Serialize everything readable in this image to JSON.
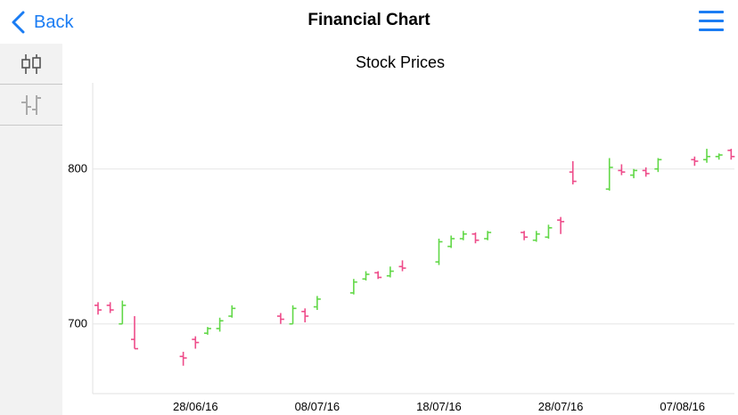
{
  "navbar": {
    "back_label": "Back",
    "title": "Financial Chart"
  },
  "icons": {
    "back": "chevron-left-icon",
    "menu": "hamburger-menu-icon",
    "candlestick": "candlestick-chart-icon",
    "ohlc": "ohlc-chart-icon"
  },
  "colors": {
    "accent": "#1a7cf3",
    "up": "#62d848",
    "down": "#ee4c8a"
  },
  "chart_data": {
    "type": "ohlc",
    "title": "Stock Prices",
    "xlabel": "",
    "ylabel": "",
    "ylim": [
      655,
      855
    ],
    "xlim": [
      "2016-06-20",
      "2016-08-12"
    ],
    "yticks": [
      700,
      800
    ],
    "xticks": [
      "28/06/16",
      "08/07/16",
      "18/07/16",
      "28/07/16",
      "07/08/16"
    ],
    "grid": true,
    "series": [
      {
        "date": "2016-06-20",
        "open": 712,
        "high": 714,
        "low": 706,
        "close": 709
      },
      {
        "date": "2016-06-21",
        "open": 712,
        "high": 714,
        "low": 707,
        "close": 709
      },
      {
        "date": "2016-06-22",
        "open": 700,
        "high": 715,
        "low": 700,
        "close": 712
      },
      {
        "date": "2016-06-23",
        "open": 690,
        "high": 705,
        "low": 684,
        "close": 684
      },
      {
        "date": "2016-06-27",
        "open": 679,
        "high": 682,
        "low": 673,
        "close": 678
      },
      {
        "date": "2016-06-28",
        "open": 690,
        "high": 692,
        "low": 684,
        "close": 688
      },
      {
        "date": "2016-06-29",
        "open": 694,
        "high": 698,
        "low": 693,
        "close": 697
      },
      {
        "date": "2016-06-30",
        "open": 697,
        "high": 704,
        "low": 695,
        "close": 702
      },
      {
        "date": "2016-07-01",
        "open": 705,
        "high": 712,
        "low": 704,
        "close": 710
      },
      {
        "date": "2016-07-05",
        "open": 705,
        "high": 707,
        "low": 700,
        "close": 703
      },
      {
        "date": "2016-07-06",
        "open": 700,
        "high": 712,
        "low": 700,
        "close": 710
      },
      {
        "date": "2016-07-07",
        "open": 708,
        "high": 710,
        "low": 701,
        "close": 705
      },
      {
        "date": "2016-07-08",
        "open": 711,
        "high": 718,
        "low": 709,
        "close": 716
      },
      {
        "date": "2016-07-11",
        "open": 720,
        "high": 729,
        "low": 719,
        "close": 727
      },
      {
        "date": "2016-07-12",
        "open": 729,
        "high": 734,
        "low": 728,
        "close": 732
      },
      {
        "date": "2016-07-13",
        "open": 733,
        "high": 734,
        "low": 729,
        "close": 730
      },
      {
        "date": "2016-07-14",
        "open": 731,
        "high": 737,
        "low": 730,
        "close": 734
      },
      {
        "date": "2016-07-15",
        "open": 737,
        "high": 741,
        "low": 734,
        "close": 736
      },
      {
        "date": "2016-07-18",
        "open": 740,
        "high": 755,
        "low": 738,
        "close": 753
      },
      {
        "date": "2016-07-19",
        "open": 750,
        "high": 757,
        "low": 749,
        "close": 755
      },
      {
        "date": "2016-07-20",
        "open": 755,
        "high": 760,
        "low": 754,
        "close": 758
      },
      {
        "date": "2016-07-21",
        "open": 758,
        "high": 759,
        "low": 752,
        "close": 754
      },
      {
        "date": "2016-07-22",
        "open": 755,
        "high": 760,
        "low": 754,
        "close": 759
      },
      {
        "date": "2016-07-25",
        "open": 759,
        "high": 760,
        "low": 754,
        "close": 756
      },
      {
        "date": "2016-07-26",
        "open": 754,
        "high": 760,
        "low": 753,
        "close": 758
      },
      {
        "date": "2016-07-27",
        "open": 756,
        "high": 764,
        "low": 755,
        "close": 762
      },
      {
        "date": "2016-07-28",
        "open": 767,
        "high": 769,
        "low": 758,
        "close": 766
      },
      {
        "date": "2016-07-29",
        "open": 798,
        "high": 805,
        "low": 790,
        "close": 792
      },
      {
        "date": "2016-08-01",
        "open": 787,
        "high": 807,
        "low": 786,
        "close": 801
      },
      {
        "date": "2016-08-02",
        "open": 799,
        "high": 803,
        "low": 796,
        "close": 798
      },
      {
        "date": "2016-08-03",
        "open": 796,
        "high": 800,
        "low": 794,
        "close": 799
      },
      {
        "date": "2016-08-04",
        "open": 799,
        "high": 801,
        "low": 795,
        "close": 797
      },
      {
        "date": "2016-08-05",
        "open": 800,
        "high": 807,
        "low": 798,
        "close": 806
      },
      {
        "date": "2016-08-08",
        "open": 806,
        "high": 808,
        "low": 802,
        "close": 805
      },
      {
        "date": "2016-08-09",
        "open": 806,
        "high": 813,
        "low": 804,
        "close": 808
      },
      {
        "date": "2016-08-10",
        "open": 808,
        "high": 810,
        "low": 806,
        "close": 809
      },
      {
        "date": "2016-08-11",
        "open": 812,
        "high": 813,
        "low": 806,
        "close": 808
      },
      {
        "date": "2016-08-12",
        "open": 805,
        "high": 808,
        "low": 804,
        "close": 807
      }
    ]
  }
}
